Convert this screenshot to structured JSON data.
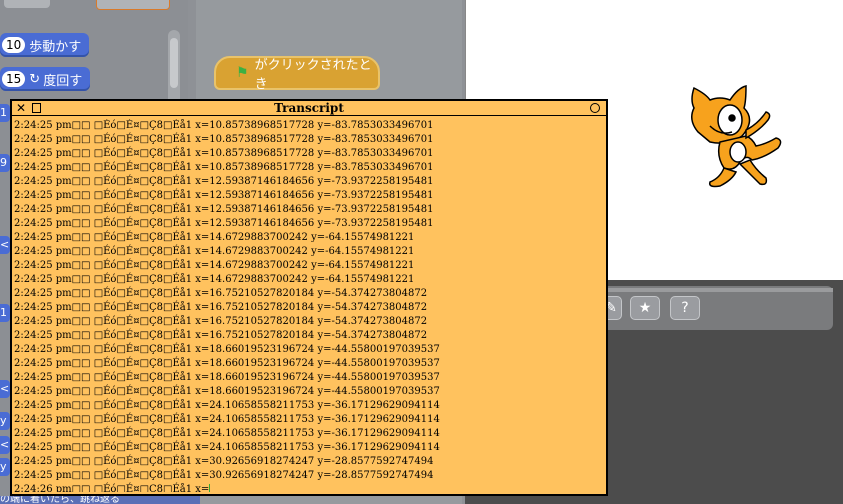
{
  "palette": {
    "blocks": [
      {
        "num": "10",
        "label": "歩動かす"
      },
      {
        "num": "15",
        "label": "度回す",
        "icon": "rotate-cw-icon"
      }
    ],
    "stubs": [
      "1",
      "9",
      "<",
      "1",
      "<",
      "<",
      "y",
      "y"
    ]
  },
  "script": {
    "hat_label": "がクリックされたとき",
    "flag_icon": "green-flag-icon"
  },
  "transcript": {
    "title": "Transcript",
    "close_glyph": "✕",
    "lines": [
      "2:24:25 pm□□ □Éó□É¤□Ç8□Éå1 x=10.85738968517728  y=-83.7853033496701",
      "2:24:25 pm□□ □Éó□É¤□Ç8□Éå1 x=10.85738968517728  y=-83.7853033496701",
      "2:24:25 pm□□ □Éó□É¤□Ç8□Éå1 x=10.85738968517728  y=-83.7853033496701",
      "2:24:25 pm□□ □Éó□É¤□Ç8□Éå1 x=10.85738968517728  y=-83.7853033496701",
      "2:24:25 pm□□ □Éó□É¤□Ç8□Éå1 x=12.59387146184656  y=-73.9372258195481",
      "2:24:25 pm□□ □Éó□É¤□Ç8□Éå1 x=12.59387146184656  y=-73.9372258195481",
      "2:24:25 pm□□ □Éó□É¤□Ç8□Éå1 x=12.59387146184656  y=-73.9372258195481",
      "2:24:25 pm□□ □Éó□É¤□Ç8□Éå1 x=12.59387146184656  y=-73.9372258195481",
      "2:24:25 pm□□ □Éó□É¤□Ç8□Éå1 x=14.6729883700242  y=-64.15574981221",
      "2:24:25 pm□□ □Éó□É¤□Ç8□Éå1 x=14.6729883700242  y=-64.15574981221",
      "2:24:25 pm□□ □Éó□É¤□Ç8□Éå1 x=14.6729883700242  y=-64.15574981221",
      "2:24:25 pm□□ □Éó□É¤□Ç8□Éå1 x=14.6729883700242  y=-64.15574981221",
      "2:24:25 pm□□ □Éó□É¤□Ç8□Éå1 x=16.7521052782018​4  y=-54.374273804872",
      "2:24:25 pm□□ □Éó□É¤□Ç8□Éå1 x=16.75210527820184  y=-54.374273804872",
      "2:24:25 pm□□ □Éó□É¤□Ç8□Éå1 x=16.75210527820184  y=-54.374273804872",
      "2:24:25 pm□□ □Éó□É¤□Ç8□Éå1 x=16.75210527820184  y=-54.374273804872",
      "2:24:25 pm□□ □Éó□É¤□Ç8□Éå1 x=18.66019523196724  y=-44.55800197039537",
      "2:24:25 pm□□ □Éó□É¤□Ç8□Éå1 x=18.66019523196724  y=-44.55800197039537",
      "2:24:25 pm□□ □Éó□É¤□Ç8□Éå1 x=18.66019523196724  y=-44.55800197039537",
      "2:24:25 pm□□ □Éó□É¤□Ç8□Éå1 x=18.66019523196724  y=-44.55800197039537",
      "2:24:25 pm□□ □Éó□É¤□Ç8□Éå1 x=24.10658558211753  y=-36.17129629094114",
      "2:24:25 pm□□ □Éó□É¤□Ç8□Éå1 x=24.10658558211753  y=-36.17129629094114",
      "2:24:25 pm□□ □Éó□É¤□Ç8□Éå1 x=24.10658558211753  y=-36.17129629094114",
      "2:24:25 pm□□ □Éó□É¤□Ç8□Éå1 x=24.10658558211753  y=-36.17129629094114",
      "2:24:25 pm□□ □Éó□É¤□Ç8□Éå1 x=30.92656918274247  y=-28.8577592747494",
      "2:24:25 pm□□ □Éó□É¤□Ç8□Éå1 x=30.92656918274247  y=-28.8577592747494"
    ],
    "last_line": "2:24:26 pm□□ □Éó□É¤□Ç8□Éå1 x="
  },
  "caption": "の端に着いたら、跳ね返る",
  "sprite_toolbar": {
    "icons": [
      "edit-icon",
      "shape-star-icon",
      "help-star-icon"
    ]
  },
  "colors": {
    "transcript_bg": "#ffc25e",
    "block_blue": "#4a6cd4",
    "hat_orange": "#d9a232",
    "cat_orange": "#f7a21d"
  }
}
